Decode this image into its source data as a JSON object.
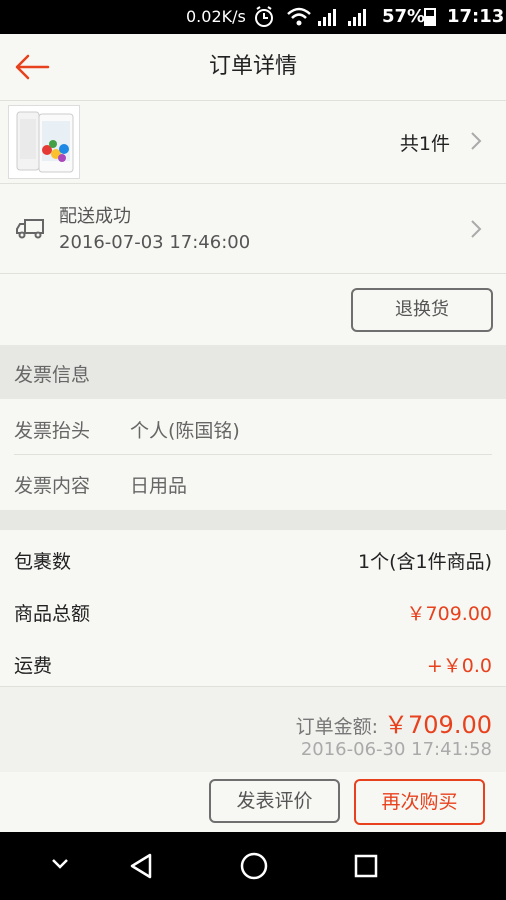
{
  "status_bar": {
    "net_speed": "0.02K/s",
    "battery_percent": "57%",
    "time": "17:13",
    "icons": [
      "alarm-icon",
      "wifi-icon",
      "cell-signal-icon",
      "cell-signal-icon"
    ]
  },
  "header": {
    "title": "订单详情",
    "back_icon": "back-arrow-icon"
  },
  "product": {
    "count_text": "共1件"
  },
  "delivery": {
    "status": "配送成功",
    "time": "2016-07-03 17:46:00"
  },
  "return_button": "退换货",
  "invoice": {
    "section_title": "发票信息",
    "rows": [
      {
        "label": "发票抬头",
        "value": "个人(陈国铭)"
      },
      {
        "label": "发票内容",
        "value": "日用品"
      }
    ]
  },
  "summary": {
    "rows": [
      {
        "label": "包裹数",
        "value": "1个(含1件商品)"
      },
      {
        "label": "商品总额",
        "value": "￥709.00"
      },
      {
        "label": "运费",
        "value": "+￥0.0"
      }
    ],
    "order_amount_label": "订单金额:",
    "order_amount": "￥709.00",
    "order_time": "2016-06-30 17:41:58"
  },
  "actions": {
    "review": "发表评价",
    "rebuy": "再次购买"
  },
  "colors": {
    "accent": "#e8411d",
    "background": "#f7f8f3",
    "section_bg": "#e7e7e3"
  }
}
